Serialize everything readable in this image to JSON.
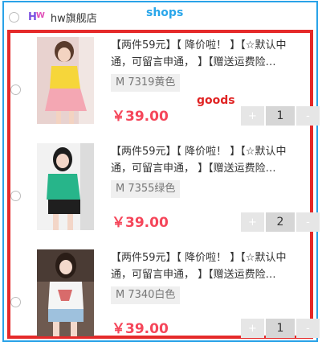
{
  "labels": {
    "shops": "shops",
    "goods": "goods"
  },
  "shop": {
    "logo_h": "H",
    "logo_w": "W",
    "name": "hw旗舰店"
  },
  "items": [
    {
      "title": "【两件59元】【 降价啦！ 】【☆默认中通，可留言申通，  】【赠送运费险…",
      "spec": "M 7319黄色",
      "price": "￥39.00",
      "quantity": "1",
      "minus": "+",
      "plus": "-",
      "thumb_colors": {
        "top": "#f6d63a",
        "bottom": "#f4a7b3",
        "bg": "#e8d2cf"
      }
    },
    {
      "title": "【两件59元】【 降价啦！ 】【☆默认中通，可留言申通，  】【赠送运费险…",
      "spec": "M 7355绿色",
      "price": "￥39.00",
      "quantity": "2",
      "minus": "+",
      "plus": "-",
      "thumb_colors": {
        "top": "#27b58a",
        "bottom": "#1f1f1f",
        "bg": "#f2f2f2"
      }
    },
    {
      "title": "【两件59元】【 降价啦！ 】【☆默认中通，可留言申通，  】【赠送运费险…",
      "spec": "M 7340白色",
      "price": "￥39.00",
      "quantity": "1",
      "minus": "+",
      "plus": "-",
      "thumb_colors": {
        "top": "#f5f5f5",
        "bottom": "#9ec1dd",
        "bg": "#6e5a50"
      }
    }
  ]
}
